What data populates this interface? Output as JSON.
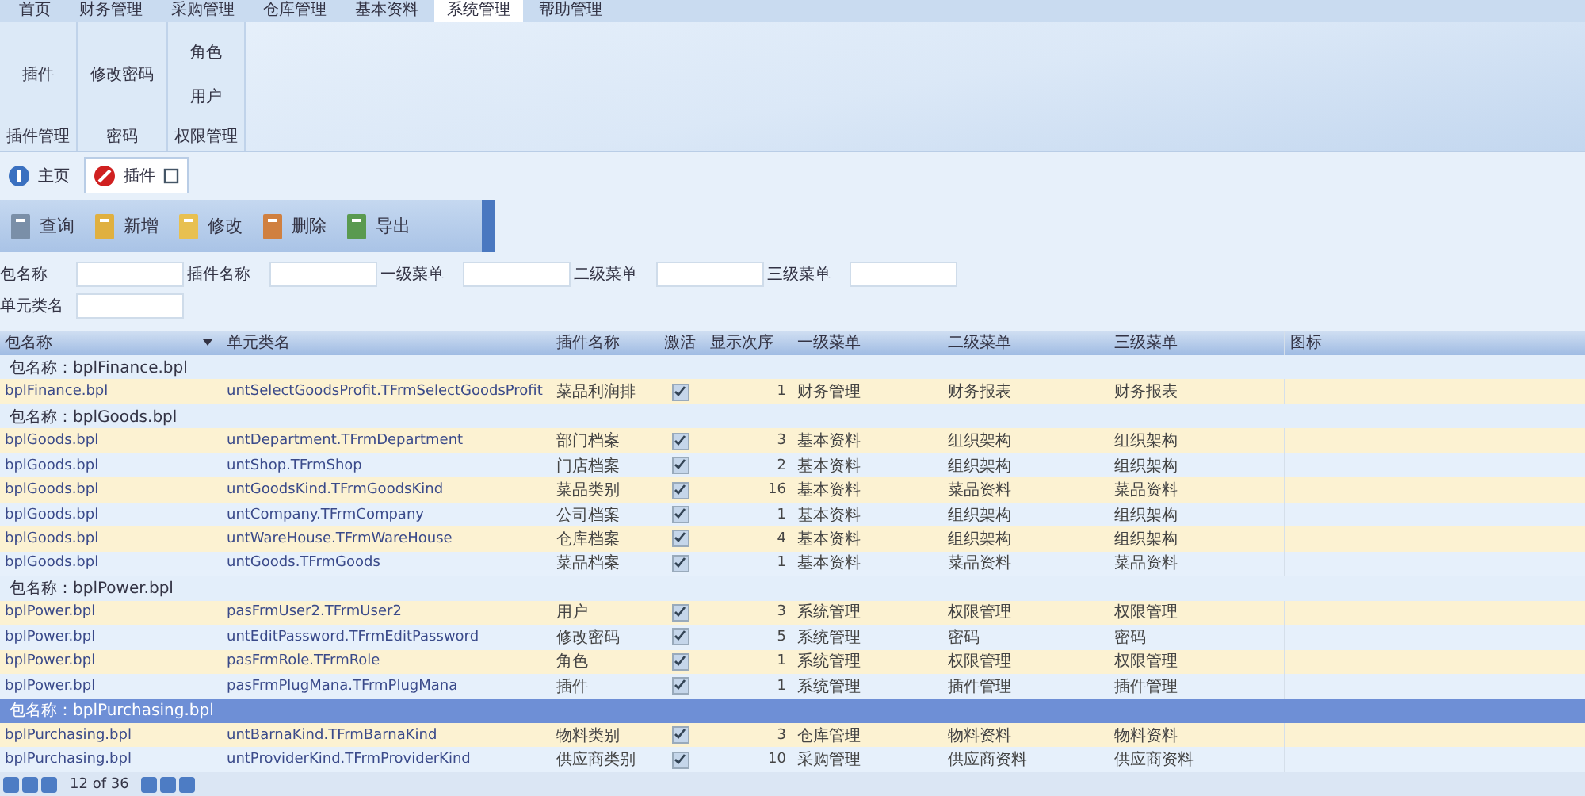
{
  "menu_tabs": [
    {
      "label": "首页",
      "selected": false
    },
    {
      "label": "财务管理",
      "selected": false
    },
    {
      "label": "采购管理",
      "selected": false
    },
    {
      "label": "仓库管理",
      "selected": false
    },
    {
      "label": "基本资料",
      "selected": false
    },
    {
      "label": "系统管理",
      "selected": true
    },
    {
      "label": "帮助管理",
      "selected": false
    }
  ],
  "ribbon_groups": [
    {
      "title": "插件管理",
      "buttons": [
        "插件"
      ]
    },
    {
      "title": "密码",
      "buttons": [
        "修改密码"
      ]
    },
    {
      "title": "权限管理",
      "buttons": [
        "角色",
        "用户"
      ]
    }
  ],
  "doc_tabs": [
    {
      "label": "主页",
      "selected": false,
      "closable": false
    },
    {
      "label": "插件",
      "selected": true,
      "closable": true
    }
  ],
  "toolbar": [
    {
      "label": "查询",
      "kind": "search"
    },
    {
      "label": "新增",
      "kind": "add"
    },
    {
      "label": "修改",
      "kind": "edit"
    },
    {
      "label": "删除",
      "kind": "delete"
    },
    {
      "label": "导出",
      "kind": "export"
    }
  ],
  "filters": [
    [
      {
        "label": "包名称"
      },
      {
        "label": "插件名称"
      },
      {
        "label": "一级菜单"
      },
      {
        "label": "二级菜单"
      },
      {
        "label": "三级菜单"
      }
    ],
    [
      {
        "label": "单元类名"
      }
    ]
  ],
  "grid": {
    "columns": [
      {
        "label": "包名称",
        "sorted": true
      },
      {
        "label": "单元类名",
        "sorted": false
      },
      {
        "label": "插件名称",
        "sorted": false
      },
      {
        "label": "激活",
        "sorted": false
      },
      {
        "label": "显示次序",
        "sorted": false
      },
      {
        "label": "一级菜单",
        "sorted": false
      },
      {
        "label": "二级菜单",
        "sorted": false
      },
      {
        "label": "三级菜单",
        "sorted": false
      },
      {
        "label": "图标",
        "sorted": false
      }
    ],
    "groups": [
      {
        "label": "包名称：bplFinance.bpl",
        "selected": false,
        "rows": [
          {
            "cells": [
              "bplFinance.bpl",
              "untSelectGoodsProfit.TFrmSelectGoodsProfit",
              "菜品利润排",
              "1",
              "财务管理",
              "财务报表",
              "财务报表"
            ],
            "checked": true
          }
        ]
      },
      {
        "label": "包名称：bplGoods.bpl",
        "selected": false,
        "rows": [
          {
            "cells": [
              "bplGoods.bpl",
              "untDepartment.TFrmDepartment",
              "部门档案",
              "3",
              "基本资料",
              "组织架构",
              "组织架构"
            ],
            "checked": true
          },
          {
            "cells": [
              "bplGoods.bpl",
              "untShop.TFrmShop",
              "门店档案",
              "2",
              "基本资料",
              "组织架构",
              "组织架构"
            ],
            "checked": true
          },
          {
            "cells": [
              "bplGoods.bpl",
              "untGoodsKind.TFrmGoodsKind",
              "菜品类别",
              "16",
              "基本资料",
              "菜品资料",
              "菜品资料"
            ],
            "checked": true
          },
          {
            "cells": [
              "bplGoods.bpl",
              "untCompany.TFrmCompany",
              "公司档案",
              "1",
              "基本资料",
              "组织架构",
              "组织架构"
            ],
            "checked": true
          },
          {
            "cells": [
              "bplGoods.bpl",
              "untWareHouse.TFrmWareHouse",
              "仓库档案",
              "4",
              "基本资料",
              "组织架构",
              "组织架构"
            ],
            "checked": true
          },
          {
            "cells": [
              "bplGoods.bpl",
              "untGoods.TFrmGoods",
              "菜品档案",
              "1",
              "基本资料",
              "菜品资料",
              "菜品资料"
            ],
            "checked": true
          }
        ]
      },
      {
        "label": "包名称：bplPower.bpl",
        "selected": false,
        "rows": [
          {
            "cells": [
              "bplPower.bpl",
              "pasFrmUser2.TFrmUser2",
              "用户",
              "3",
              "系统管理",
              "权限管理",
              "权限管理"
            ],
            "checked": true
          },
          {
            "cells": [
              "bplPower.bpl",
              "untEditPassword.TFrmEditPassword",
              "修改密码",
              "5",
              "系统管理",
              "密码",
              "密码"
            ],
            "checked": true
          },
          {
            "cells": [
              "bplPower.bpl",
              "pasFrmRole.TFrmRole",
              "角色",
              "1",
              "系统管理",
              "权限管理",
              "权限管理"
            ],
            "checked": true
          },
          {
            "cells": [
              "bplPower.bpl",
              "pasFrmPlugMana.TFrmPlugMana",
              "插件",
              "1",
              "系统管理",
              "插件管理",
              "插件管理"
            ],
            "checked": true
          }
        ]
      },
      {
        "label": "包名称：bplPurchasing.bpl",
        "selected": true,
        "rows": [
          {
            "cells": [
              "bplPurchasing.bpl",
              "untBarnaKind.TFrmBarnaKind",
              "物料类别",
              "3",
              "仓库管理",
              "物料资料",
              "物料资料"
            ],
            "checked": true
          },
          {
            "cells": [
              "bplPurchasing.bpl",
              "untProviderKind.TFrmProviderKind",
              "供应商类别",
              "10",
              "采购管理",
              "供应商资料",
              "供应商资料"
            ],
            "checked": true
          }
        ]
      }
    ]
  },
  "pager": {
    "text": "12 of 36"
  }
}
